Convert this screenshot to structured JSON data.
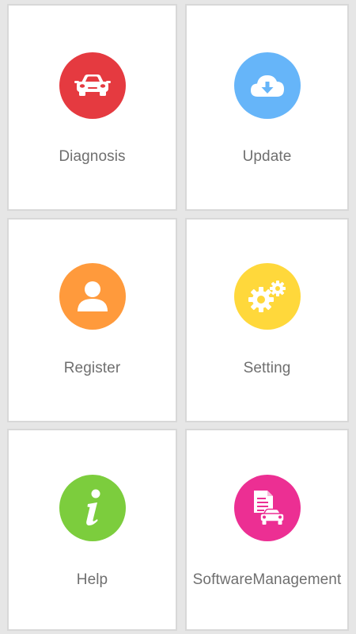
{
  "tiles": [
    {
      "label": "Diagnosis",
      "icon": "car-icon",
      "color": "#e53a40"
    },
    {
      "label": "Update",
      "icon": "cloud-download-icon",
      "color": "#66b5f9"
    },
    {
      "label": "Register",
      "icon": "user-icon",
      "color": "#ff9a3c"
    },
    {
      "label": "Setting",
      "icon": "gears-icon",
      "color": "#ffd83b"
    },
    {
      "label": "Help",
      "icon": "info-icon",
      "color": "#7ccd3d"
    },
    {
      "label": "SoftwareManagement",
      "icon": "document-car-icon",
      "color": "#ec2f93"
    }
  ]
}
